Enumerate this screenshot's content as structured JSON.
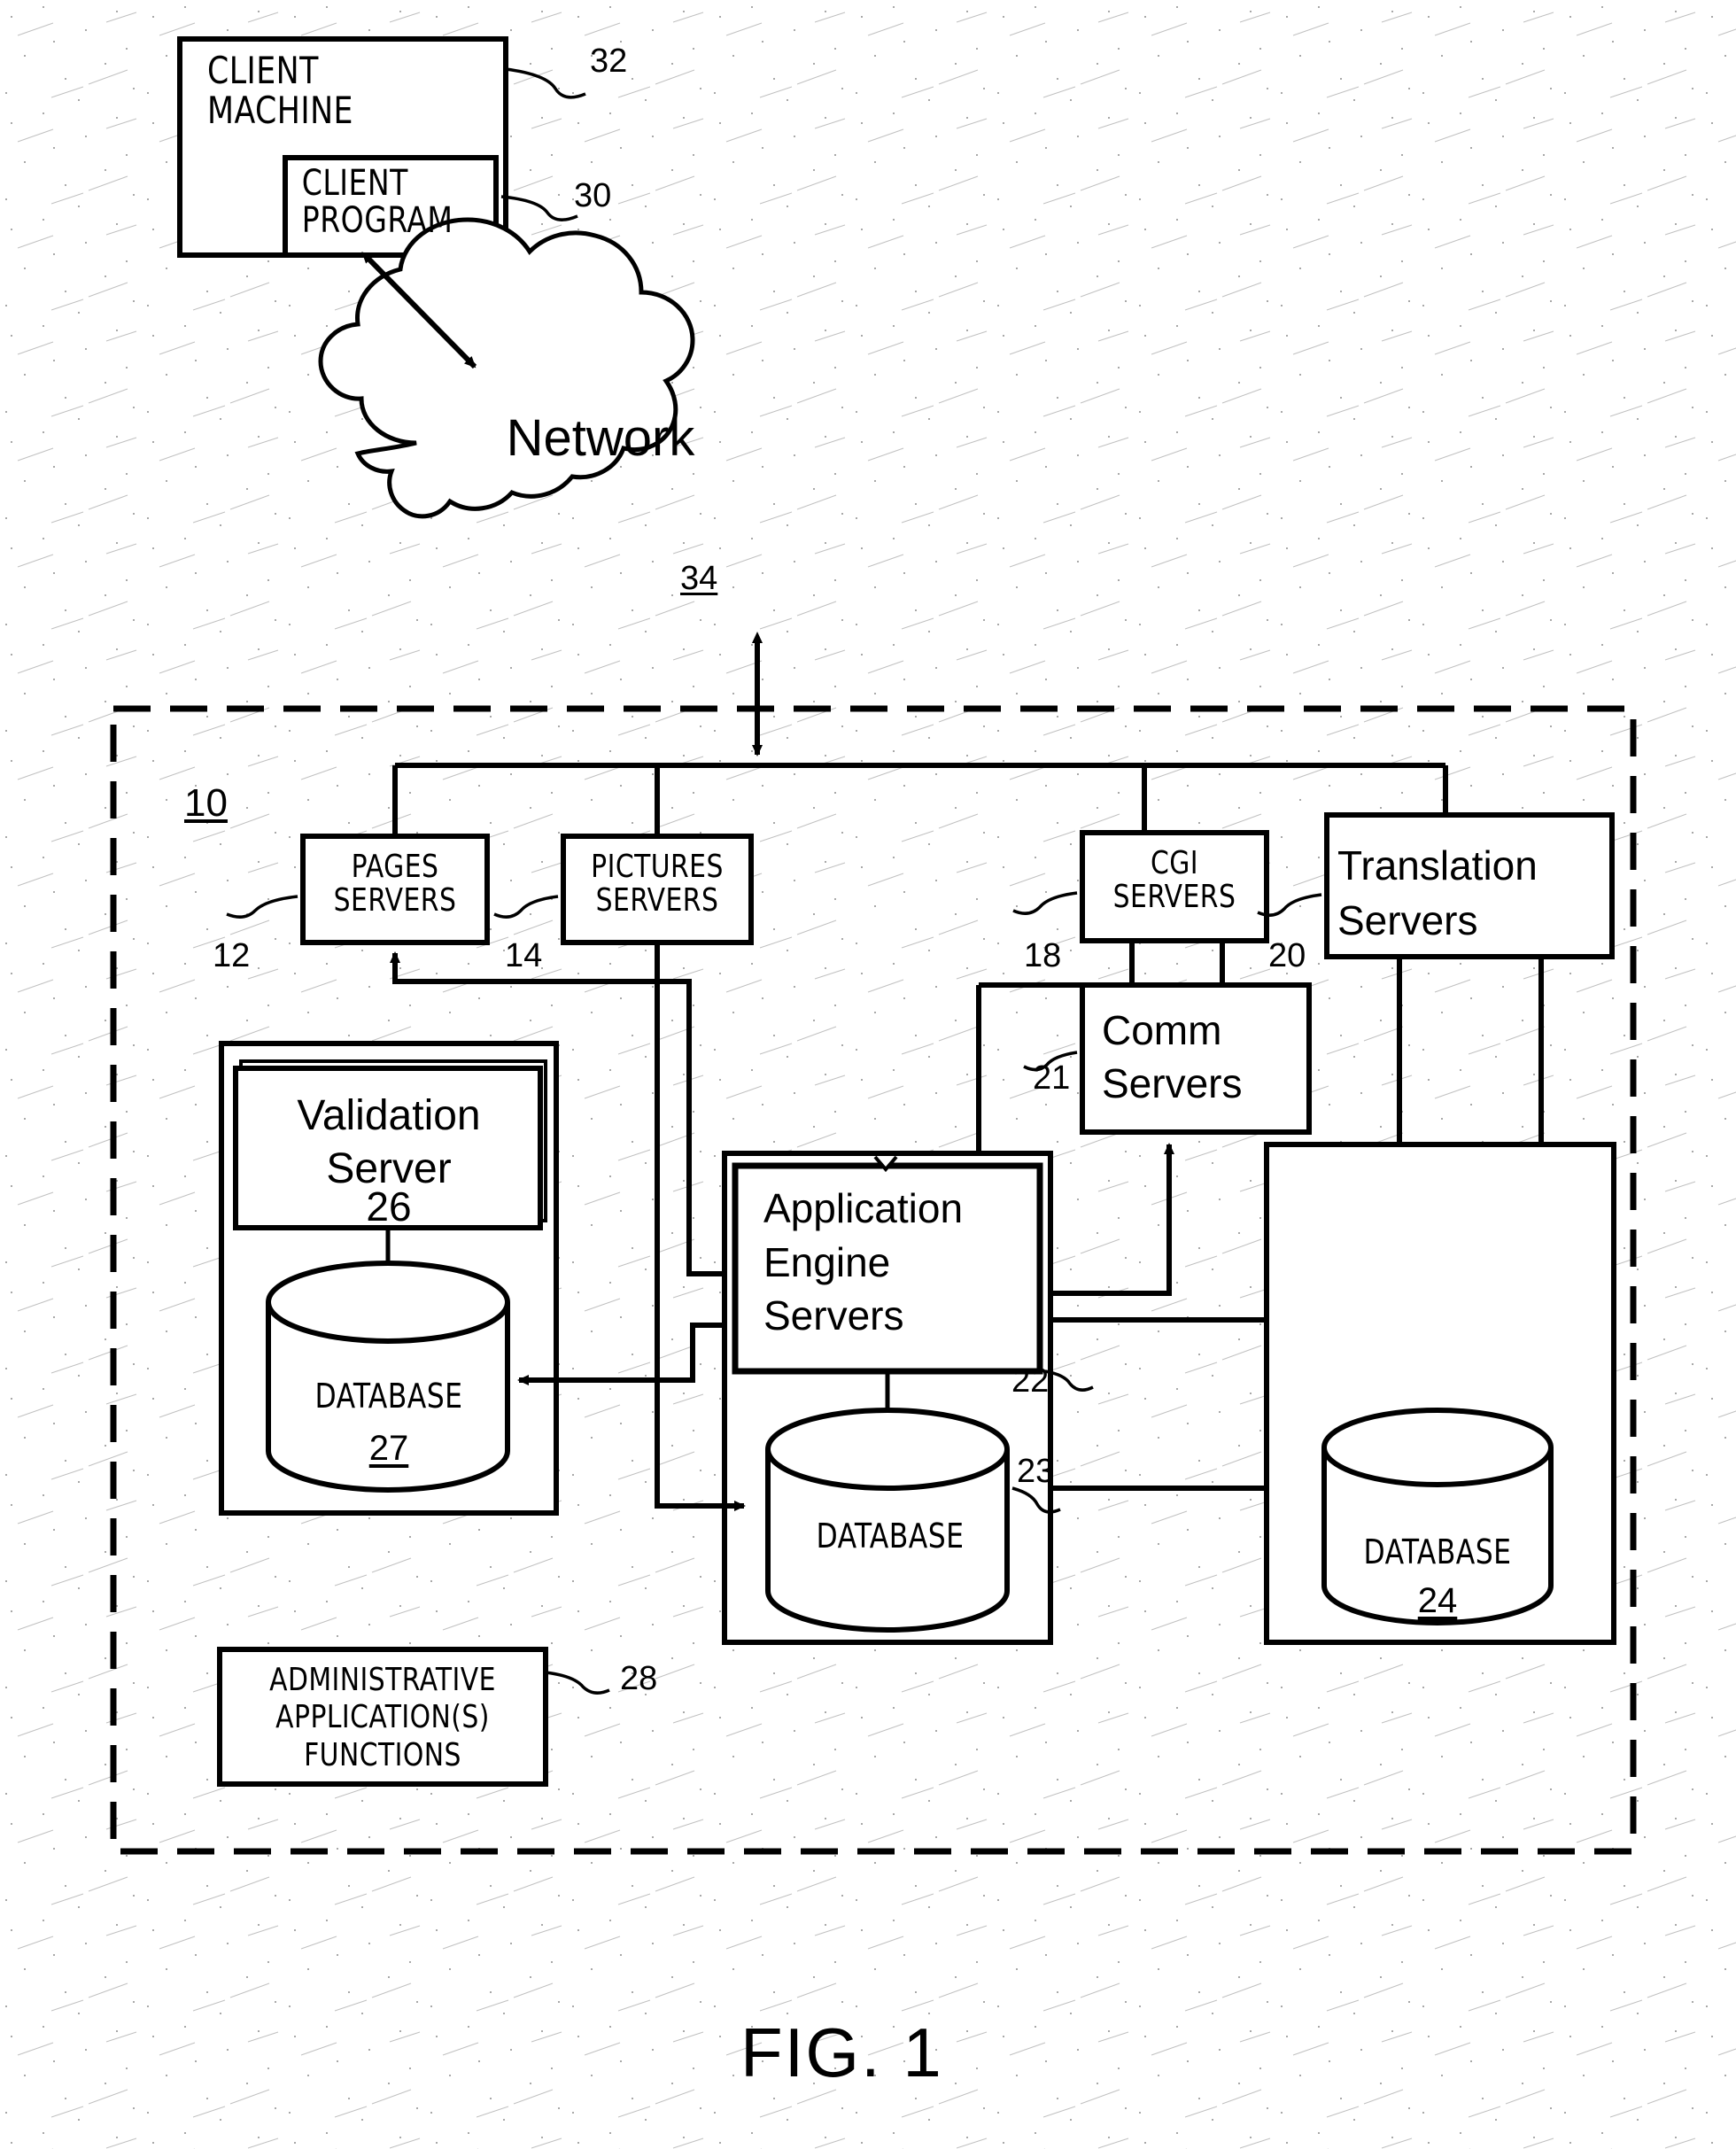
{
  "figure": {
    "caption": "FIG. 1",
    "system_ref": "10"
  },
  "nodes": {
    "client_machine": {
      "label": "CLIENT\nMACHINE",
      "ref": "32"
    },
    "client_program": {
      "label": "CLIENT\nPROGRAM",
      "ref": "30"
    },
    "network": {
      "label": "Network",
      "ref": "34"
    },
    "pages_servers": {
      "label": "PAGES\nSERVERS",
      "ref": "12"
    },
    "pictures_servers": {
      "label": "PICTURES\nSERVERS",
      "ref": "14"
    },
    "cgi_servers": {
      "label": "CGI\nSERVERS",
      "ref": "18"
    },
    "translation_servers": {
      "label": "Translation\nServers",
      "ref": "20"
    },
    "comm_servers": {
      "label": "Comm\nServers",
      "ref": "21"
    },
    "validation_server": {
      "label": "Validation\nServer",
      "ref": "26"
    },
    "validation_database": {
      "label": "DATABASE",
      "ref": "27"
    },
    "app_engine_servers": {
      "label": "Application\nEngine\nServers",
      "ref": "22"
    },
    "app_database": {
      "label": "DATABASE",
      "ref": "23"
    },
    "translation_database": {
      "label": "DATABASE",
      "ref": "24"
    },
    "admin_functions": {
      "label": "ADMINISTRATIVE\nAPPLICATION(S)\nFUNCTIONS",
      "ref": "28"
    }
  },
  "colors": {
    "ink": "#000000",
    "paper": "#ffffff",
    "speckle": "#9a9a9a"
  }
}
